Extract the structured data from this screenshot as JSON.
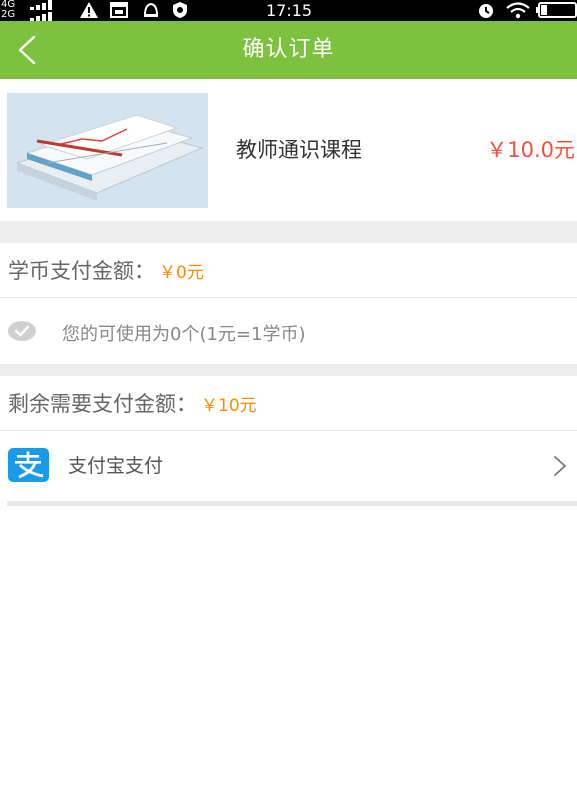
{
  "status_bar": {
    "network_top": "4G",
    "network_bottom": "2G",
    "time": "17:15"
  },
  "header": {
    "title": "确认订单"
  },
  "product": {
    "name": "教师通识课程",
    "price": "￥10.0元"
  },
  "coin_payment": {
    "label": "学币支付金额：",
    "amount": "￥0元",
    "available_text": "您的可使用为0个(1元=1学币)"
  },
  "remaining": {
    "label": "剩余需要支付金额：",
    "amount": "￥10元"
  },
  "payment_method": {
    "label": "支付宝支付"
  },
  "colors": {
    "header_green": "#7dc23e",
    "price_red": "#ff4c3b",
    "amount_orange": "#ff8c00",
    "alipay_blue": "#1a9be8"
  }
}
